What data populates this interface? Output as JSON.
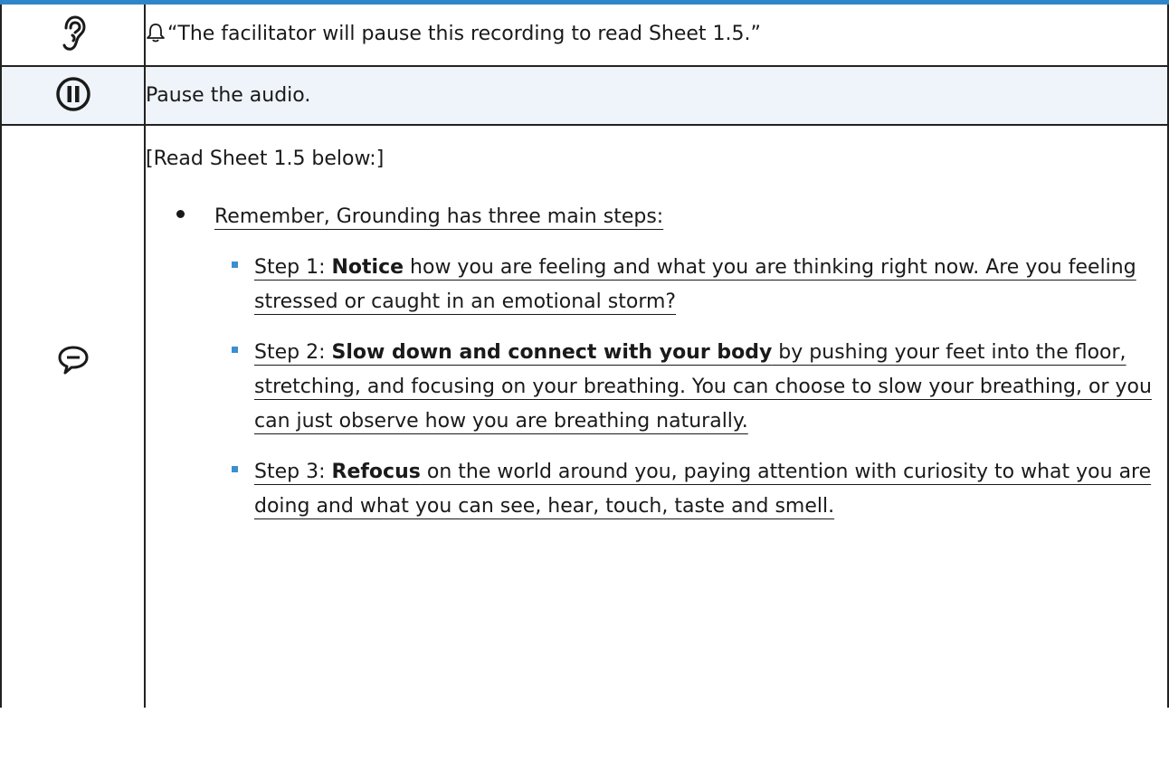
{
  "colors": {
    "accent_bar": "#2e86c9",
    "bullet_square": "#3a8fd0",
    "shaded_row": "#eef4f9"
  },
  "rows": [
    {
      "icon": "ear-icon",
      "bell_icon": "bell-icon",
      "text": "“The facilitator will pause this recording to read Sheet 1.5.”"
    },
    {
      "icon": "pause-icon",
      "text": "Pause the audio."
    },
    {
      "icon": "speech-bubble-icon",
      "lead": "[Read Sheet 1.5 below:]",
      "bullet": "Remember, Grounding has three main steps:",
      "steps": [
        {
          "prefix": "Step 1: ",
          "bold": "Notice",
          "rest": " how you are feeling and what you are thinking right now. Are you feeling stressed or caught in an emotional storm?"
        },
        {
          "prefix": "Step 2: ",
          "bold": "Slow down and connect with your body",
          "rest": " by pushing your feet into the floor, stretching, and focusing on your breathing. You can choose to slow your breathing, or you can just observe how you are breathing naturally."
        },
        {
          "prefix": "Step 3: ",
          "bold": "Refocus",
          "rest": " on the world around you, paying attention with curiosity to what you are doing and what you can see, hear, touch, taste and smell."
        }
      ]
    }
  ]
}
